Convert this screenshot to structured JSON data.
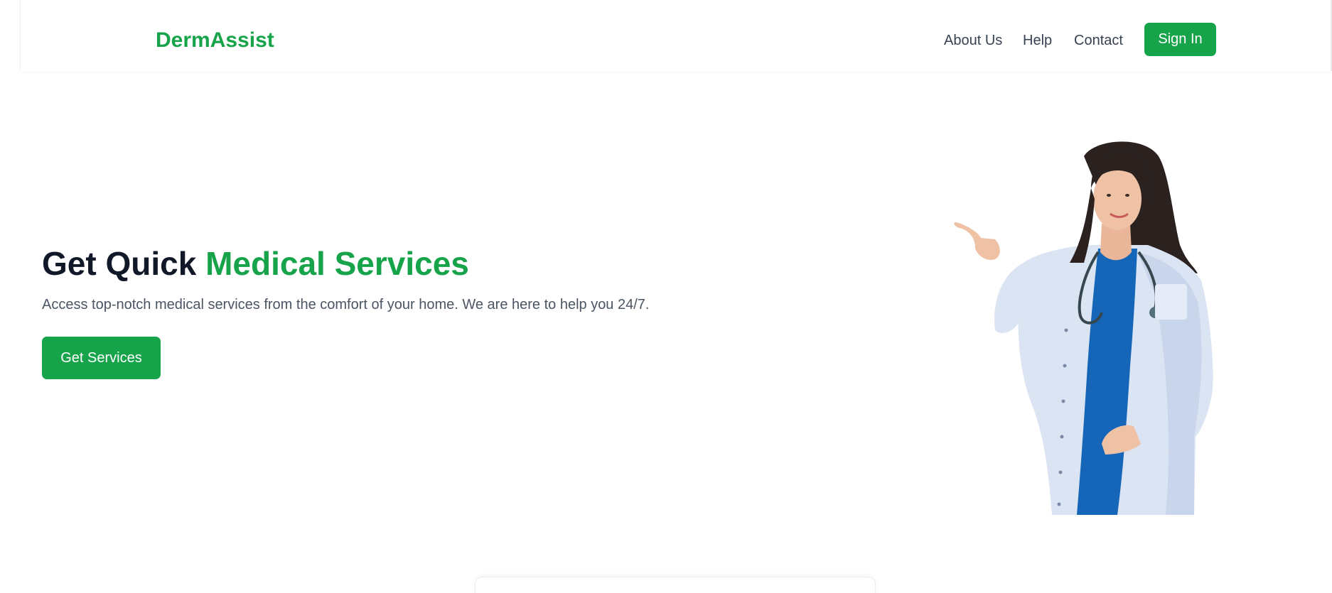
{
  "header": {
    "logo": "DermAssist",
    "nav": [
      {
        "label": "About Us"
      },
      {
        "label": "Help"
      },
      {
        "label": "Contact"
      }
    ],
    "signin_label": "Sign In"
  },
  "hero": {
    "title_part1": "Get Quick",
    "title_part2": "Medical Services",
    "description": "Access top-notch medical services from the comfort of your home. We are here to help you 24/7.",
    "cta_label": "Get Services"
  },
  "colors": {
    "brand": "#16a34a",
    "heading": "#111827",
    "text": "#4b5563",
    "nav": "#374151"
  },
  "illustration": {
    "icon": "doctor-illustration"
  }
}
